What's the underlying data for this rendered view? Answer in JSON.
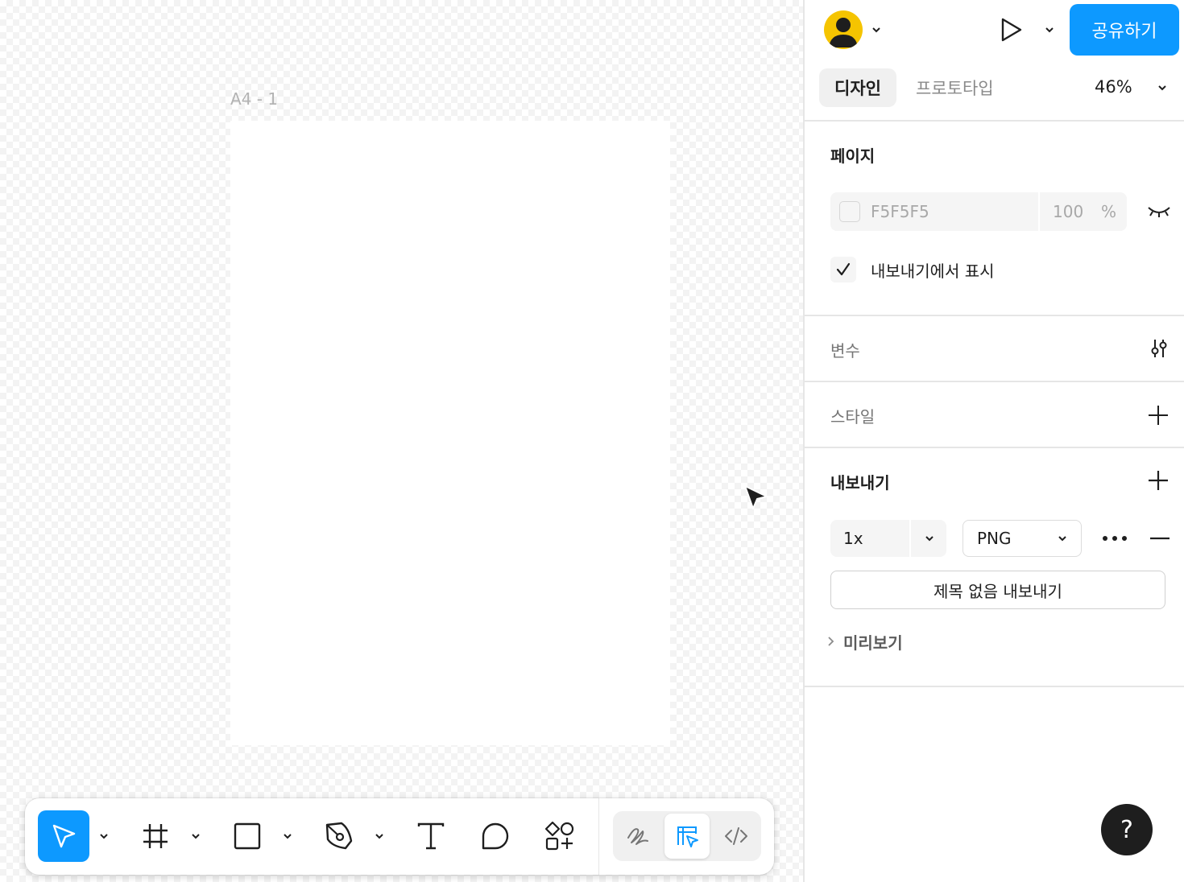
{
  "canvas": {
    "frame_label": "A4 - 1"
  },
  "toolbar": {
    "tools": [
      {
        "name": "move",
        "icon": "cursor-arrow-icon",
        "active": true
      },
      {
        "name": "frame",
        "icon": "frame-hash-icon"
      },
      {
        "name": "shape",
        "icon": "rectangle-icon"
      },
      {
        "name": "pen",
        "icon": "pen-icon"
      },
      {
        "name": "text",
        "icon": "text-icon"
      },
      {
        "name": "comment",
        "icon": "comment-bubble-icon"
      },
      {
        "name": "assets",
        "icon": "shapes-plus-icon"
      }
    ],
    "modes": [
      {
        "name": "draw",
        "icon": "scribble-icon"
      },
      {
        "name": "design",
        "icon": "design-mode-icon",
        "active": true
      },
      {
        "name": "dev",
        "icon": "code-icon"
      }
    ],
    "accent_color": "#0d99ff"
  },
  "header": {
    "share_label": "공유하기",
    "tabs": [
      "디자인",
      "프로토타입"
    ],
    "active_tab": "디자인",
    "zoom": "46%"
  },
  "page_section": {
    "title": "페이지",
    "background_hex": "F5F5F5",
    "opacity": "100",
    "opacity_unit": "%",
    "show_in_exports_label": "내보내기에서 표시",
    "show_in_exports_checked": true
  },
  "variables_section": {
    "title": "변수"
  },
  "styles_section": {
    "title": "스타일"
  },
  "export_section": {
    "title": "내보내기",
    "scale": "1x",
    "format": "PNG",
    "export_button": "제목 없음 내보내기",
    "preview_label": "미리보기"
  },
  "help": {
    "label": "?"
  }
}
